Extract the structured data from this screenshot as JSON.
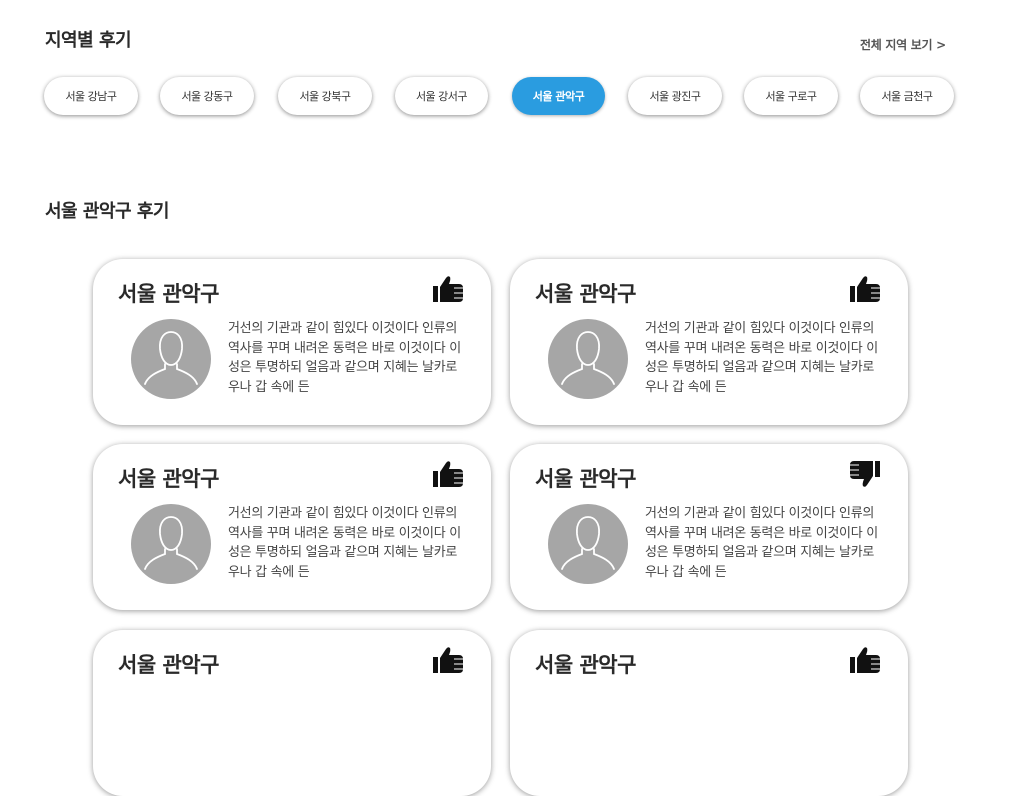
{
  "region_section": {
    "title": "지역별 후기",
    "view_all": "전체 지역 보기 >",
    "chips": [
      "서울 강남구",
      "서울 강동구",
      "서울 강북구",
      "서울 강서구",
      "서울 관악구",
      "서울 광진구",
      "서울 구로구",
      "서울 금천구"
    ],
    "selected": "서울 관악구"
  },
  "review_section": {
    "title": "서울 관악구 후기",
    "cards": [
      {
        "title": "서울 관악구",
        "rating": "thumbs-up",
        "text": "거선의 기관과 같이 힘있다 이것이다 인류의 역사를 꾸며 내려온 동력은 바로 이것이다 이성은 투명하되 얼음과 같으며 지혜는 날카로우나 갑 속에 든"
      },
      {
        "title": "서울 관악구",
        "rating": "thumbs-up",
        "text": "거선의 기관과 같이 힘있다 이것이다 인류의 역사를 꾸며 내려온 동력은 바로 이것이다 이성은 투명하되 얼음과 같으며 지혜는 날카로우나 갑 속에 든"
      },
      {
        "title": "서울 관악구",
        "rating": "thumbs-up",
        "text": "거선의 기관과 같이 힘있다 이것이다 인류의 역사를 꾸며 내려온 동력은 바로 이것이다 이성은 투명하되 얼음과 같으며 지혜는 날카로우나 갑 속에 든"
      },
      {
        "title": "서울 관악구",
        "rating": "thumbs-down",
        "text": "거선의 기관과 같이 힘있다 이것이다 인류의 역사를 꾸며 내려온 동력은 바로 이것이다 이성은 투명하되 얼음과 같으며 지혜는 날카로우나 갑 속에 든"
      },
      {
        "title": "서울 관악구",
        "rating": "thumbs-up",
        "text": ""
      },
      {
        "title": "서울 관악구",
        "rating": "thumbs-up",
        "text": ""
      }
    ]
  },
  "colors": {
    "accent": "#2a9ce0",
    "avatar_bg": "#a6a6a6",
    "icon": "#111111"
  }
}
